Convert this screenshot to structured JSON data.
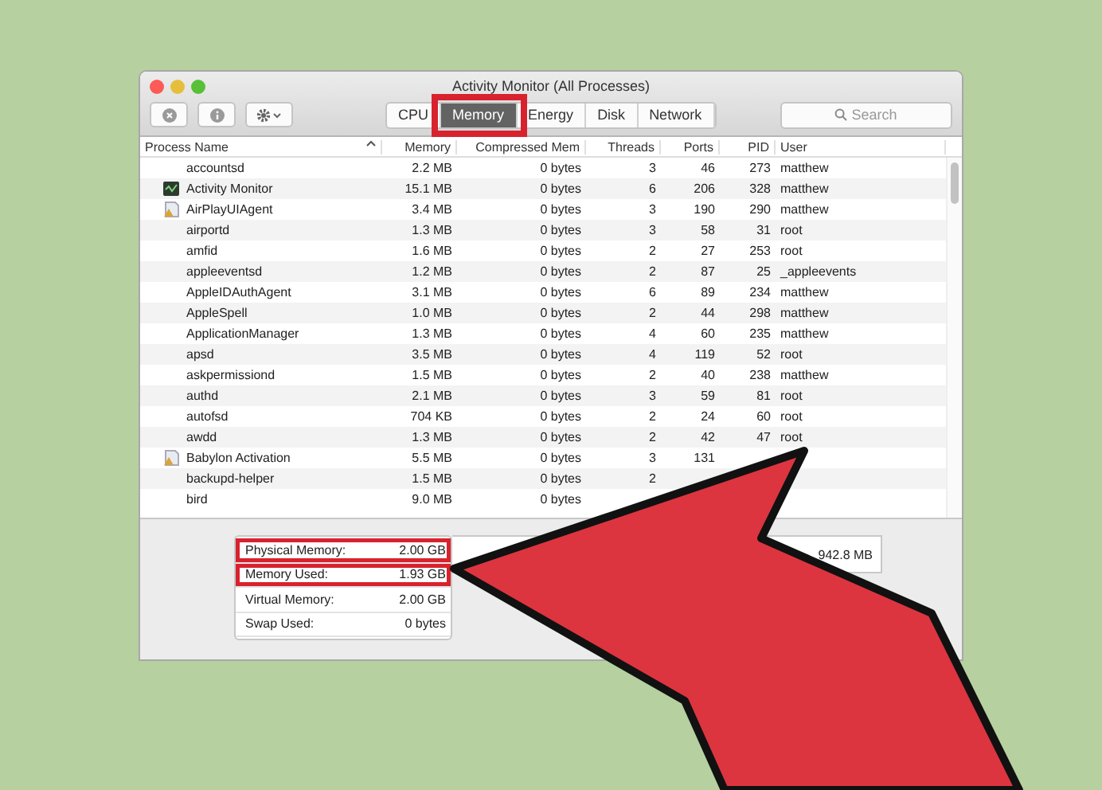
{
  "window": {
    "title": "Activity Monitor (All Processes)"
  },
  "toolbar": {
    "tabs": [
      {
        "label": "CPU",
        "selected": false,
        "highlighted": false
      },
      {
        "label": "Memory",
        "selected": true,
        "highlighted": true
      },
      {
        "label": "Energy",
        "selected": false,
        "highlighted": false
      },
      {
        "label": "Disk",
        "selected": false,
        "highlighted": false
      },
      {
        "label": "Network",
        "selected": false,
        "highlighted": false
      }
    ],
    "search": {
      "placeholder": "Search"
    }
  },
  "table": {
    "columns": [
      "Process Name",
      "Memory",
      "Compressed Mem",
      "Threads",
      "Ports",
      "PID",
      "User"
    ],
    "rows": [
      {
        "name": "accountsd",
        "kind": "plain",
        "memory": "2.2 MB",
        "compressed": "0 bytes",
        "threads": "3",
        "ports": "46",
        "pid": "273",
        "user": "matthew"
      },
      {
        "name": "Activity Monitor",
        "kind": "monitor",
        "memory": "15.1 MB",
        "compressed": "0 bytes",
        "threads": "6",
        "ports": "206",
        "pid": "328",
        "user": "matthew"
      },
      {
        "name": "AirPlayUIAgent",
        "kind": "app",
        "memory": "3.4 MB",
        "compressed": "0 bytes",
        "threads": "3",
        "ports": "190",
        "pid": "290",
        "user": "matthew"
      },
      {
        "name": "airportd",
        "memory": "1.3 MB",
        "compressed": "0 bytes",
        "threads": "3",
        "ports": "58",
        "pid": "31",
        "user": "root"
      },
      {
        "name": "amfid",
        "memory": "1.6 MB",
        "compressed": "0 bytes",
        "threads": "2",
        "ports": "27",
        "pid": "253",
        "user": "root"
      },
      {
        "name": "appleeventsd",
        "memory": "1.2 MB",
        "compressed": "0 bytes",
        "threads": "2",
        "ports": "87",
        "pid": "25",
        "user": "_appleevents"
      },
      {
        "name": "AppleIDAuthAgent",
        "memory": "3.1 MB",
        "compressed": "0 bytes",
        "threads": "6",
        "ports": "89",
        "pid": "234",
        "user": "matthew"
      },
      {
        "name": "AppleSpell",
        "memory": "1.0 MB",
        "compressed": "0 bytes",
        "threads": "2",
        "ports": "44",
        "pid": "298",
        "user": "matthew"
      },
      {
        "name": "ApplicationManager",
        "memory": "1.3 MB",
        "compressed": "0 bytes",
        "threads": "4",
        "ports": "60",
        "pid": "235",
        "user": "matthew"
      },
      {
        "name": "apsd",
        "memory": "3.5 MB",
        "compressed": "0 bytes",
        "threads": "4",
        "ports": "119",
        "pid": "52",
        "user": "root"
      },
      {
        "name": "askpermissiond",
        "memory": "1.5 MB",
        "compressed": "0 bytes",
        "threads": "2",
        "ports": "40",
        "pid": "238",
        "user": "matthew"
      },
      {
        "name": "authd",
        "memory": "2.1 MB",
        "compressed": "0 bytes",
        "threads": "3",
        "ports": "59",
        "pid": "81",
        "user": "root"
      },
      {
        "name": "autofsd",
        "memory": "704 KB",
        "compressed": "0 bytes",
        "threads": "2",
        "ports": "24",
        "pid": "60",
        "user": "root"
      },
      {
        "name": "awdd",
        "memory": "1.3 MB",
        "compressed": "0 bytes",
        "threads": "2",
        "ports": "42",
        "pid": "47",
        "user": "root"
      },
      {
        "name": "Babylon Activation",
        "kind": "app",
        "memory": "5.5 MB",
        "compressed": "0 bytes",
        "threads": "3",
        "ports": "131"
      },
      {
        "name": "backupd-helper",
        "memory": "1.5 MB",
        "compressed": "0 bytes",
        "threads": "2"
      },
      {
        "name": "bird",
        "memory": "9.0 MB",
        "compressed": "0 bytes"
      }
    ]
  },
  "memory_stats": [
    {
      "label": "Physical Memory:",
      "value": "2.00 GB",
      "highlighted": true
    },
    {
      "label": "Memory Used:",
      "value": "1.93 GB",
      "highlighted": true
    },
    {
      "label": "Virtual Memory:",
      "value": "2.00 GB",
      "highlighted": false
    },
    {
      "label": "Swap Used:",
      "value": "0 bytes",
      "highlighted": false
    }
  ],
  "memory_reading": "942.8 MB"
}
